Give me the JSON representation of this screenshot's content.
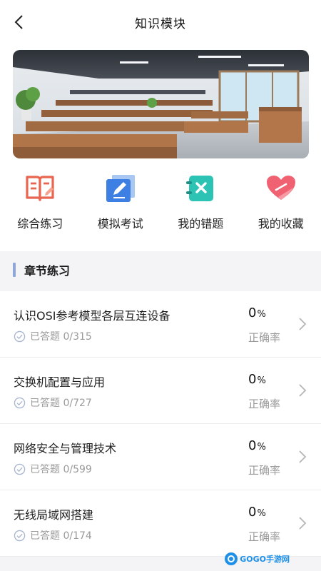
{
  "header": {
    "title": "知识模块"
  },
  "banner": {
    "alt": "classroom photo"
  },
  "quick_actions": [
    {
      "label": "综合练习",
      "icon": "book-icon",
      "color": "#e8654f"
    },
    {
      "label": "模拟考试",
      "icon": "pencil-icon",
      "color": "#3e7fe3"
    },
    {
      "label": "我的错题",
      "icon": "notebook-x-icon",
      "color": "#2cc3b5"
    },
    {
      "label": "我的收藏",
      "icon": "heart-icon",
      "color": "#ee5a6a"
    }
  ],
  "section": {
    "title": "章节练习"
  },
  "chapters": [
    {
      "title": "认识OSI参考模型各层互连设备",
      "answered": "已答题 0/315",
      "rate": "0",
      "rate_unit": "%",
      "rate_label": "正确率"
    },
    {
      "title": "交换机配置与应用",
      "answered": "已答题 0/727",
      "rate": "0",
      "rate_unit": "%",
      "rate_label": "正确率"
    },
    {
      "title": "网络安全与管理技术",
      "answered": "已答题 0/599",
      "rate": "0",
      "rate_unit": "%",
      "rate_label": "正确率"
    },
    {
      "title": "无线局域网搭建",
      "answered": "已答题 0/174",
      "rate": "0",
      "rate_unit": "%",
      "rate_label": "正确率"
    }
  ],
  "watermark": {
    "text": "GOGO手游网"
  },
  "colors": {
    "accent": "#8ea6d8",
    "check": "#a9b6d0"
  }
}
